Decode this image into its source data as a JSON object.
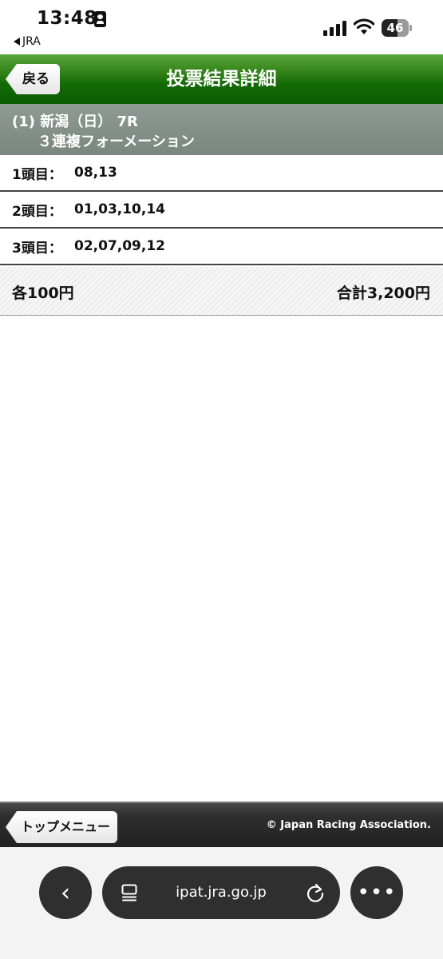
{
  "status": {
    "time": "13:48",
    "back_app": "JRA",
    "battery": "46"
  },
  "header": {
    "back_label": "戻る",
    "title": "投票結果詳細"
  },
  "race": {
    "line1": "(1) 新潟（日） 7R",
    "line2": "３連複フォーメーション"
  },
  "picks": [
    {
      "label": "1頭目：",
      "value": "08,13"
    },
    {
      "label": "2頭目：",
      "value": "01,03,10,14"
    },
    {
      "label": "3頭目：",
      "value": "02,07,09,12"
    }
  ],
  "totals": {
    "each": "各100円",
    "sum": "合計3,200円"
  },
  "footer": {
    "top_menu_label": "トップメニュー",
    "copyright": "© Japan Racing Association."
  },
  "browser": {
    "url": "ipat.jra.go.jp",
    "back_symbol": "‹",
    "more_symbol": "•••"
  },
  "icons": {
    "id_badge": "id-badge-icon",
    "signal": "cellular-signal-icon",
    "wifi": "wifi-icon",
    "battery": "battery-icon",
    "tabs": "tab-overview-icon",
    "reload": "reload-icon"
  }
}
